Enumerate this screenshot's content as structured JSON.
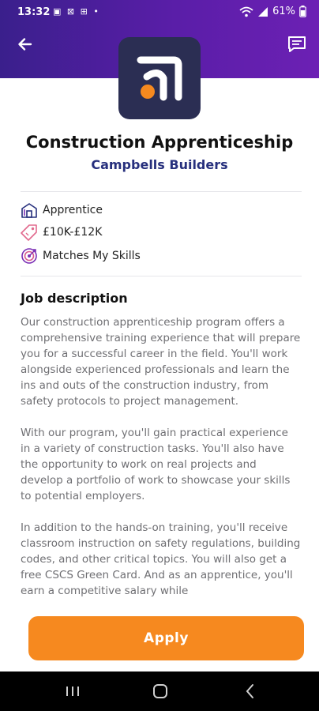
{
  "status_bar": {
    "time": "13:32",
    "notification_icons": "▣ ⊠ ⊞ •",
    "wifi_icon": "wifi-icon",
    "signal_icon": "signal-icon",
    "battery": "61%"
  },
  "job": {
    "title": "Construction Apprenticeship",
    "company": "Campbells Builders"
  },
  "tags": [
    {
      "icon": "house-icon",
      "label": "Apprentice"
    },
    {
      "icon": "price-tag-icon",
      "label": "£10K-£12K"
    },
    {
      "icon": "target-icon",
      "label": "Matches My Skills"
    }
  ],
  "description": {
    "heading": "Job description",
    "paragraphs": [
      "Our construction apprenticeship program offers a comprehensive training experience that will prepare you for a successful career in the field. You'll work alongside experienced professionals and learn the ins and outs of the construction industry, from safety protocols to project management.",
      "With our program, you'll gain practical experience in a variety of construction tasks. You'll also have the opportunity to work on real projects and develop a portfolio of work to showcase your skills to potential employers.",
      "In addition to the hands-on training, you'll receive classroom instruction on safety regulations, building codes, and other critical topics. You will also get a free CSCS Green Card. And as an apprentice, you'll earn a competitive salary while"
    ]
  },
  "actions": {
    "apply_label": "Apply"
  },
  "colors": {
    "header_start": "#3a1f8c",
    "header_end": "#6c20b4",
    "accent_orange": "#f6891f",
    "company_blue": "#27307d",
    "logo_bg": "#2b2e53"
  }
}
